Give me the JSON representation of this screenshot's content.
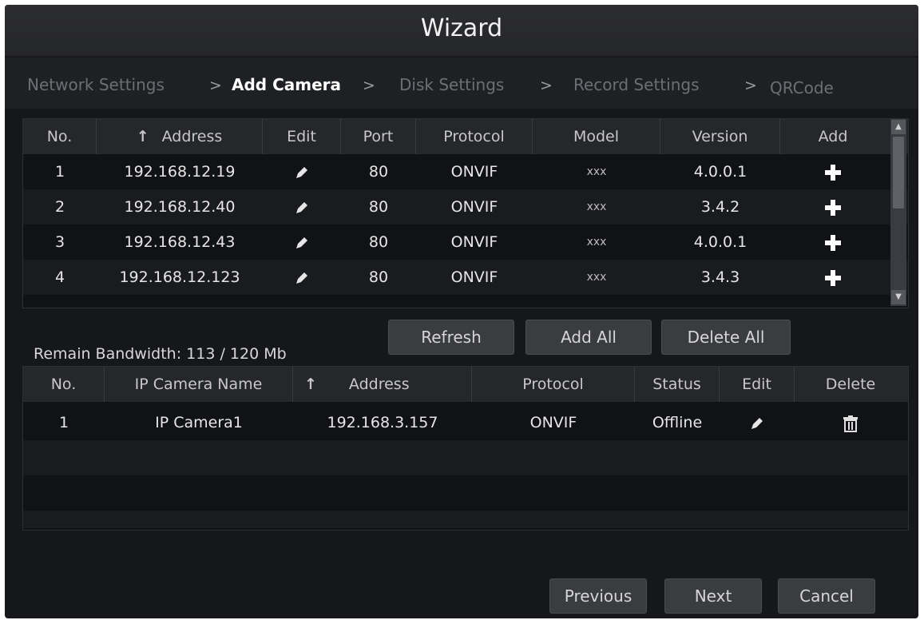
{
  "window": {
    "title": "Wizard"
  },
  "steps": [
    {
      "label": "Network Settings",
      "active": false
    },
    {
      "label": "Add Camera",
      "active": true
    },
    {
      "label": "Disk Settings",
      "active": false
    },
    {
      "label": "Record Settings",
      "active": false
    },
    {
      "label": "QRCode",
      "active": false
    }
  ],
  "step_separator": ">",
  "search_table": {
    "columns": [
      "No.",
      "Address",
      "Edit",
      "Port",
      "Protocol",
      "Model",
      "Version",
      "Add"
    ],
    "rows": [
      {
        "no": "1",
        "address": "192.168.12.19",
        "port": "80",
        "protocol": "ONVIF",
        "model": "xxx",
        "version": "4.0.0.1"
      },
      {
        "no": "2",
        "address": "192.168.12.40",
        "port": "80",
        "protocol": "ONVIF",
        "model": "xxx",
        "version": "3.4.2"
      },
      {
        "no": "3",
        "address": "192.168.12.43",
        "port": "80",
        "protocol": "ONVIF",
        "model": "xxx",
        "version": "4.0.0.1"
      },
      {
        "no": "4",
        "address": "192.168.12.123",
        "port": "80",
        "protocol": "ONVIF",
        "model": "xxx",
        "version": "3.4.3"
      }
    ]
  },
  "actions": {
    "refresh": "Refresh",
    "add_all": "Add All",
    "delete_all": "Delete All"
  },
  "bandwidth": {
    "label": "Remain Bandwidth: 113 / 120 Mb"
  },
  "added_table": {
    "columns": [
      "No.",
      "IP Camera Name",
      "Address",
      "Protocol",
      "Status",
      "Edit",
      "Delete"
    ],
    "rows": [
      {
        "no": "1",
        "name": "IP Camera1",
        "address": "192.168.3.157",
        "protocol": "ONVIF",
        "status": "Offline"
      }
    ]
  },
  "footer": {
    "previous": "Previous",
    "next": "Next",
    "cancel": "Cancel"
  },
  "icons": {
    "sort": "sort-arrow-icon",
    "edit": "pencil-icon",
    "add": "plus-icon",
    "delete": "trash-icon"
  },
  "colors": {
    "background": "#16171a",
    "header": "#26272b",
    "button": "#3a3c40"
  }
}
